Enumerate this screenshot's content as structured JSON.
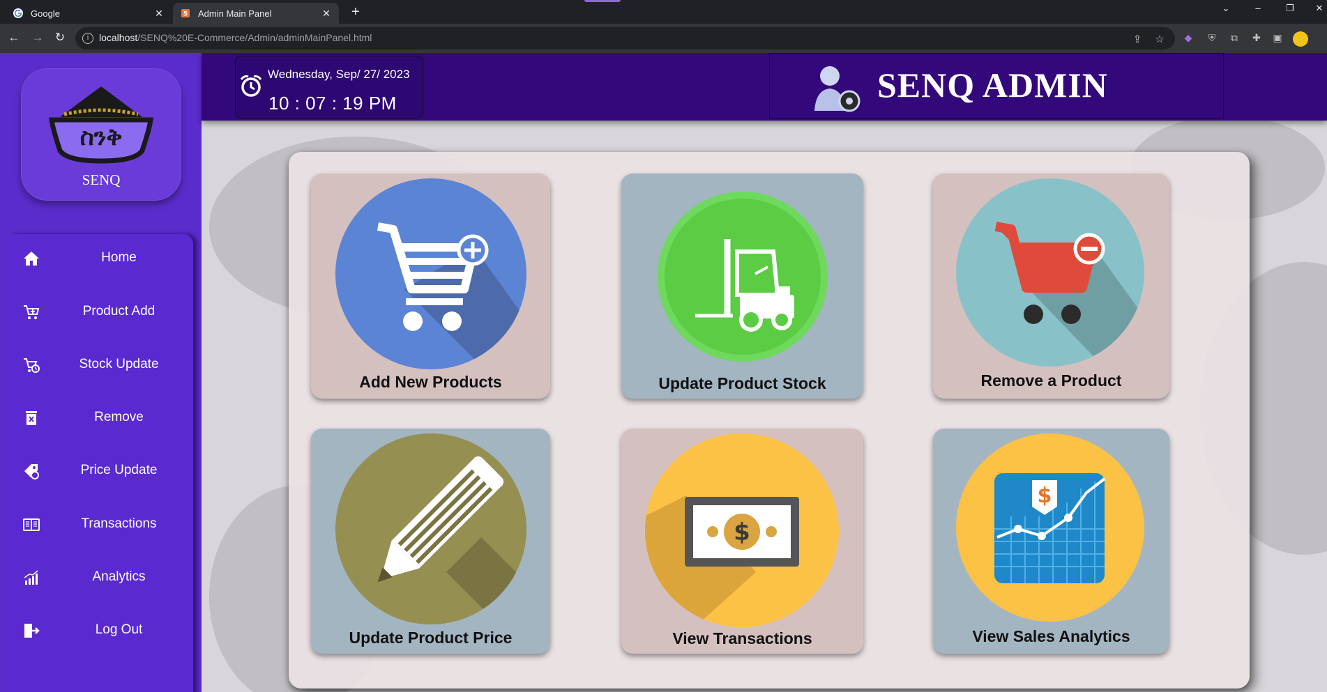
{
  "browser": {
    "tabs": [
      {
        "title": "Google",
        "favicon": "google-icon",
        "active": false
      },
      {
        "title": "Admin Main Panel",
        "favicon": "html-icon",
        "active": true
      }
    ],
    "url_host": "localhost",
    "url_path": "/SENQ%20E-Commerce/Admin/adminMainPanel.html"
  },
  "sidebar": {
    "logo_text": "SENQ",
    "logo_script": "ስንቅ",
    "items": [
      {
        "label": "Home",
        "icon": "home-icon"
      },
      {
        "label": "Product Add",
        "icon": "cart-add-icon"
      },
      {
        "label": "Stock Update",
        "icon": "cart-clock-icon"
      },
      {
        "label": "Remove",
        "icon": "trash-icon"
      },
      {
        "label": "Price Update",
        "icon": "price-tag-icon"
      },
      {
        "label": "Transactions",
        "icon": "receipt-book-icon"
      },
      {
        "label": "Analytics",
        "icon": "analytics-icon"
      },
      {
        "label": "Log Out",
        "icon": "logout-icon"
      }
    ]
  },
  "header": {
    "date": "Wednesday, Sep/ 27/ 2023",
    "time": "10 : 07 : 19 PM",
    "brand": "SENQ ADMIN"
  },
  "cards": [
    {
      "label": "Add New Products",
      "icon": "cart-plus-icon"
    },
    {
      "label": "Update Product Stock",
      "icon": "forklift-icon"
    },
    {
      "label": "Remove a Product",
      "icon": "cart-minus-icon"
    },
    {
      "label": "Update Product Price",
      "icon": "pencil-icon"
    },
    {
      "label": "View Transactions",
      "icon": "money-bill-icon"
    },
    {
      "label": "View Sales Analytics",
      "icon": "sales-chart-icon"
    }
  ],
  "colors": {
    "sidebar": "#5b2ccc",
    "topbar": "#33087a",
    "accent_blue": "#5b84d4",
    "accent_green": "#5bcc44",
    "accent_teal": "#88c2c8",
    "accent_olive": "#958f52",
    "accent_yellow": "#fbc246"
  }
}
